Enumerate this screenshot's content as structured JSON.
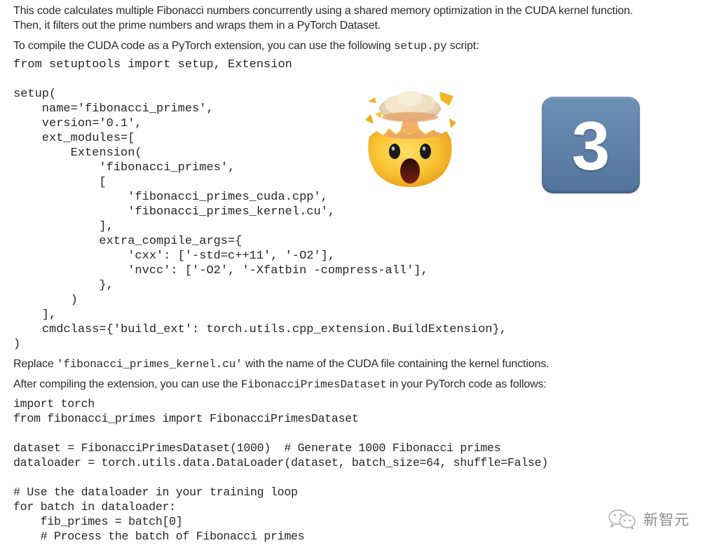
{
  "intro": {
    "line1": "This code calculates multiple Fibonacci numbers concurrently using a shared memory optimization in the CUDA kernel function.",
    "line2": "Then, it filters out the prime numbers and wraps them in a PyTorch Dataset.",
    "compile_pre": "To compile the CUDA code as a PyTorch extension, you can use the following ",
    "compile_code": "setup.py",
    "compile_post": " script:"
  },
  "setup_code": {
    "import_line": "from setuptools import setup, Extension",
    "lines": [
      "setup(",
      "    name='fibonacci_primes',",
      "    version='0.1',",
      "    ext_modules=[",
      "        Extension(",
      "            'fibonacci_primes',",
      "            [",
      "                'fibonacci_primes_cuda.cpp',",
      "                'fibonacci_primes_kernel.cu',",
      "            ],",
      "            extra_compile_args={",
      "                'cxx': ['-std=c++11', '-O2'],",
      "                'nvcc': ['-O2', '-Xfatbin -compress-all'],",
      "            },",
      "        )",
      "    ],",
      "    cmdclass={'build_ext': torch.utils.cpp_extension.BuildExtension},",
      ")"
    ]
  },
  "replace_note": {
    "pre": "Replace ",
    "code": "'fibonacci_primes_kernel.cu'",
    "post": " with the name of the CUDA file containing the kernel functions."
  },
  "after_note": {
    "pre": "After compiling the extension, you can use the ",
    "code": "FibonacciPrimesDataset",
    "post": " in your PyTorch code as follows:"
  },
  "usage_code": {
    "lines": [
      "import torch",
      "from fibonacci_primes import FibonacciPrimesDataset",
      "",
      "dataset = FibonacciPrimesDataset(1000)  # Generate 1000 Fibonacci primes",
      "dataloader = torch.utils.data.DataLoader(dataset, batch_size=64, shuffle=False)",
      "",
      "# Use the dataloader in your training loop",
      "for batch in dataloader:",
      "    fib_primes = batch[0]",
      "    # Process the batch of Fibonacci primes"
    ]
  },
  "emojis": {
    "exploding_head": "exploding-head-icon",
    "keycap": "3"
  },
  "watermark": {
    "icon": "wechat-icon",
    "text": "新智元"
  },
  "colors": {
    "keycap_blue": "#6384ab",
    "emoji_yellow": "#f7c338",
    "text": "#2a2a2a"
  }
}
